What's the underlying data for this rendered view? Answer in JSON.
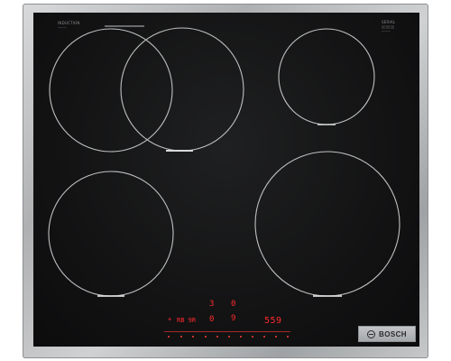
{
  "panel_labels": {
    "top_left": [
      "INDUCTION",
      "------"
    ],
    "top_right": [
      "SERIAL",
      "▯▯▯▯▯▯",
      "------"
    ]
  },
  "controls": {
    "row1_left": "3",
    "row1_right": "0",
    "row2_left_text": "RB 9R",
    "row2_mid": "0",
    "row2_mid_right": "9",
    "timer_display": "559",
    "small_flag": "+"
  },
  "brand": {
    "name": "BOSCH"
  },
  "colors": {
    "glass": "#131314",
    "zone_outline": "#bfc1c3",
    "zone_indicator": "#d8dadb",
    "display_red": "#ff2b2b",
    "frame_steel": "#b5b7b9"
  }
}
